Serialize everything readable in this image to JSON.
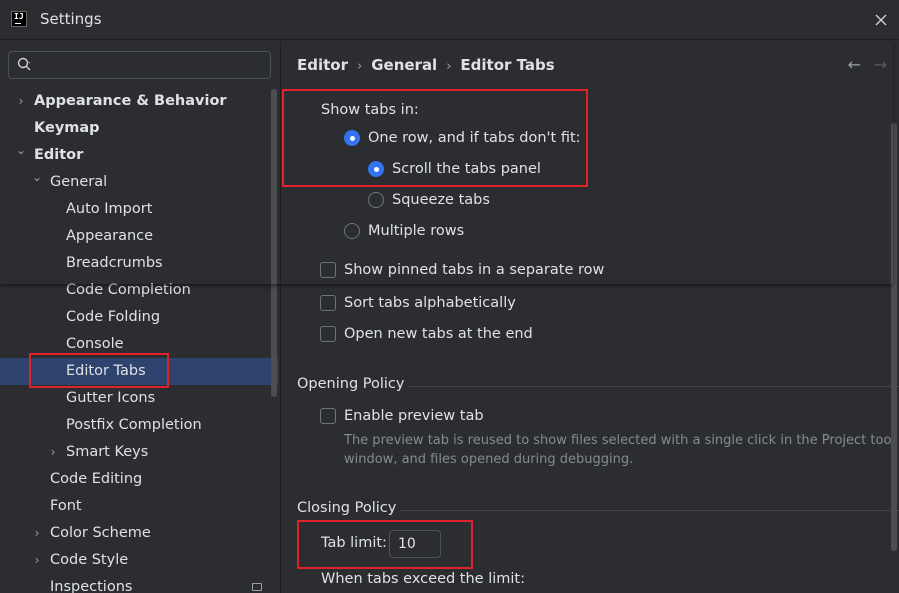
{
  "window": {
    "title": "Settings",
    "logo_text": "IJ"
  },
  "search": {
    "value": "",
    "placeholder": ""
  },
  "tree": [
    {
      "label": "Appearance & Behavior",
      "level": 0,
      "expandable": "collapsed",
      "bold": true
    },
    {
      "label": "Keymap",
      "level": 0,
      "expandable": "none",
      "bold": true
    },
    {
      "label": "Editor",
      "level": 0,
      "expandable": "expanded",
      "bold": true
    },
    {
      "label": "General",
      "level": 1,
      "expandable": "expanded",
      "bold": false
    },
    {
      "label": "Auto Import",
      "level": 2,
      "expandable": "none",
      "bold": false
    },
    {
      "label": "Appearance",
      "level": 2,
      "expandable": "none",
      "bold": false
    },
    {
      "label": "Breadcrumbs",
      "level": 2,
      "expandable": "none",
      "bold": false
    },
    {
      "label": "Code Completion",
      "level": 2,
      "expandable": "none",
      "bold": false
    },
    {
      "label": "Code Folding",
      "level": 2,
      "expandable": "none",
      "bold": false
    },
    {
      "label": "Console",
      "level": 2,
      "expandable": "none",
      "bold": false
    },
    {
      "label": "Editor Tabs",
      "level": 2,
      "expandable": "none",
      "bold": false,
      "selected": true
    },
    {
      "label": "Gutter Icons",
      "level": 2,
      "expandable": "none",
      "bold": false
    },
    {
      "label": "Postfix Completion",
      "level": 2,
      "expandable": "none",
      "bold": false
    },
    {
      "label": "Smart Keys",
      "level": 2,
      "expandable": "collapsed",
      "bold": false
    },
    {
      "label": "Code Editing",
      "level": 1,
      "expandable": "none",
      "bold": false
    },
    {
      "label": "Font",
      "level": 1,
      "expandable": "none",
      "bold": false
    },
    {
      "label": "Color Scheme",
      "level": 1,
      "expandable": "collapsed",
      "bold": false
    },
    {
      "label": "Code Style",
      "level": 1,
      "expandable": "collapsed",
      "bold": false
    },
    {
      "label": "Inspections",
      "level": 1,
      "expandable": "none",
      "bold": false
    }
  ],
  "breadcrumb": {
    "items": [
      "Editor",
      "General",
      "Editor Tabs"
    ],
    "separator": "›"
  },
  "nav": {
    "back": "←",
    "forward": "→"
  },
  "show_tabs": {
    "label": "Show tabs in:",
    "one_row": {
      "label": "One row, and if tabs don't fit:",
      "checked": true
    },
    "scroll": {
      "label": "Scroll the tabs panel",
      "checked": true
    },
    "squeeze": {
      "label": "Squeeze tabs",
      "checked": false
    },
    "multiple": {
      "label": "Multiple rows",
      "checked": false
    }
  },
  "checkboxes": {
    "pinned": {
      "label": "Show pinned tabs in a separate row",
      "checked": false
    },
    "sort": {
      "label": "Sort tabs alphabetically",
      "checked": false
    },
    "open_end": {
      "label": "Open new tabs at the end",
      "checked": false
    }
  },
  "opening_policy": {
    "title": "Opening Policy",
    "preview": {
      "label": "Enable preview tab",
      "checked": false
    },
    "hint_line1": "The preview tab is reused to show files selected with a single click in the Project tool",
    "hint_line2": "window, and files opened during debugging."
  },
  "closing_policy": {
    "title": "Closing Policy",
    "tab_limit_label": "Tab limit:",
    "tab_limit_value": "10",
    "exceed_label": "When tabs exceed the limit:"
  },
  "colors": {
    "selection": "#2e436e",
    "accent": "#3574f0",
    "highlight": "#e0222d",
    "background": "#2b2d30"
  }
}
